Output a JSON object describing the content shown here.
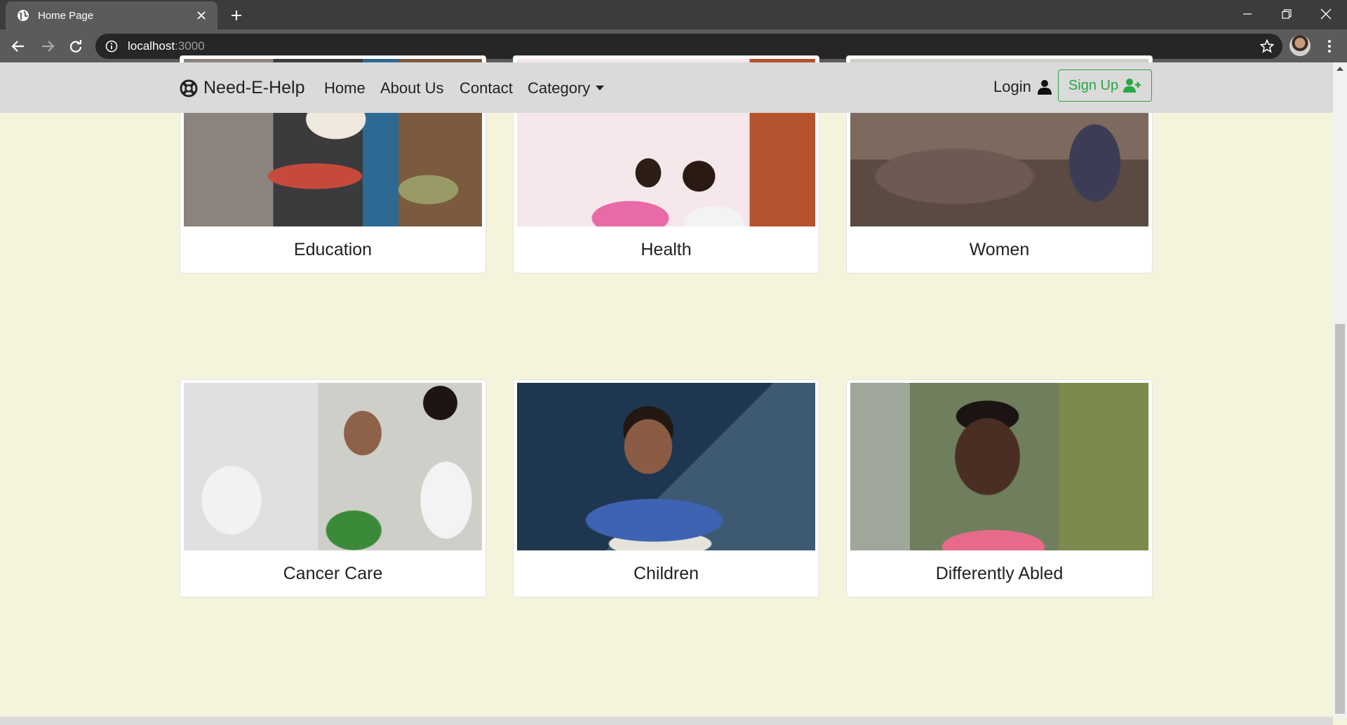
{
  "browser": {
    "tab_title": "Home Page",
    "url_host": "localhost",
    "url_port": ":3000",
    "icons": {
      "favicon": "globe-icon",
      "tab_close": "close-icon",
      "new_tab": "plus-icon",
      "back": "arrow-left-icon",
      "forward": "arrow-right-icon",
      "reload": "reload-icon",
      "site_info": "info-icon",
      "bookmark": "star-icon",
      "menu": "more-vertical-icon",
      "minimize": "minimize-icon",
      "restore": "restore-icon",
      "close_window": "close-icon"
    }
  },
  "navbar": {
    "brand": "Need-E-Help",
    "brand_icon": "life-ring-icon",
    "links": [
      "Home",
      "About Us",
      "Contact",
      "Category"
    ],
    "login_label": "Login",
    "login_icon": "user-icon",
    "signup_label": "Sign Up",
    "signup_icon": "user-plus-icon",
    "signup_color": "#28a745",
    "background": "#dadada"
  },
  "page": {
    "background": "#f4f4dd"
  },
  "cards": [
    {
      "title": "Education",
      "image": "girl studying on floor"
    },
    {
      "title": "Health",
      "image": "doctor examining patient's eye"
    },
    {
      "title": "Women",
      "image": "group of women"
    },
    {
      "title": "Cancer Care",
      "image": "doctor examining elderly woman"
    },
    {
      "title": "Children",
      "image": "girl resting on desk"
    },
    {
      "title": "Differently Abled",
      "image": "smiling child"
    }
  ]
}
